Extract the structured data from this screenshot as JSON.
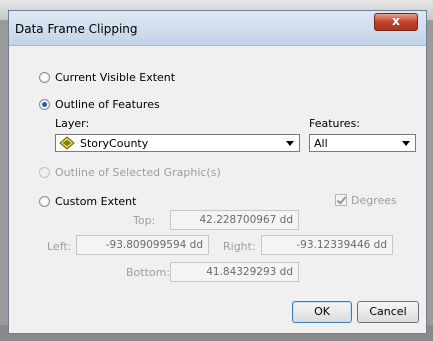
{
  "dialog": {
    "title": "Data Frame Clipping",
    "close_label": "x"
  },
  "options": {
    "current_visible_extent": "Current Visible Extent",
    "outline_of_features": "Outline of Features",
    "outline_selected_graphics": "Outline of Selected Graphic(s)",
    "custom_extent": "Custom Extent",
    "selected": "outline_of_features"
  },
  "layer": {
    "label": "Layer:",
    "value": "StoryCounty"
  },
  "features": {
    "label": "Features:",
    "value": "All"
  },
  "degrees": {
    "label": "Degrees",
    "checked": true
  },
  "extent": {
    "top_label": "Top:",
    "top_value": "42.228700967 dd",
    "left_label": "Left:",
    "left_value": "-93.809099594 dd",
    "right_label": "Right:",
    "right_value": "-93.12339446 dd",
    "bottom_label": "Bottom:",
    "bottom_value": "41.84329293 dd"
  },
  "buttons": {
    "ok": "OK",
    "cancel": "Cancel"
  },
  "colors": {
    "title_gradient_top": "#dfe9f5",
    "close_red": "#c0442c",
    "radio_dot": "#1c5fb6"
  }
}
